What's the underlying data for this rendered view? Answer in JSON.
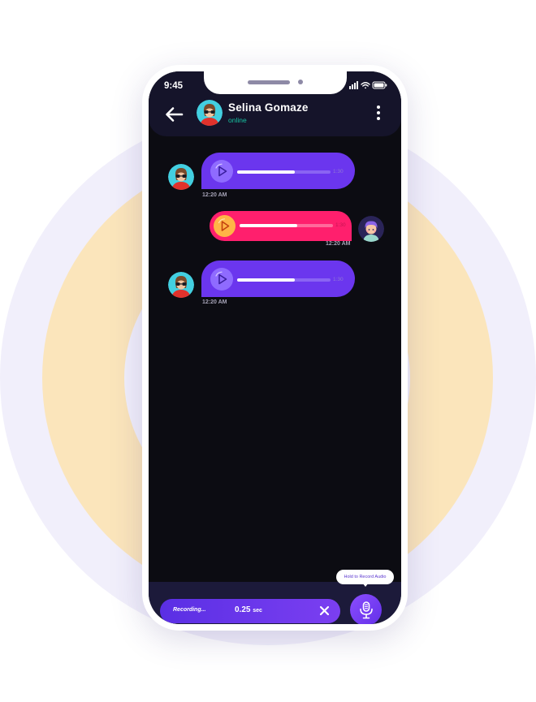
{
  "status_bar": {
    "time": "9:45"
  },
  "header": {
    "contact_name": "Selina Gomaze",
    "contact_status": "online",
    "icons": [
      "back-arrow-icon",
      "avatar",
      "more-vertical-icon"
    ]
  },
  "messages": [
    {
      "type": "voice",
      "direction": "received",
      "duration": "1:30",
      "time": "12:20 AM",
      "progress": 0.62,
      "color": "#6b36ee"
    },
    {
      "type": "voice",
      "direction": "sent",
      "duration": "1:30",
      "time": "12:20 AM",
      "progress": 0.62,
      "color": "#ff1f6d"
    },
    {
      "type": "voice",
      "direction": "received",
      "duration": "1:30",
      "time": "12:20 AM",
      "progress": 0.62,
      "color": "#6b36ee"
    }
  ],
  "recorder": {
    "status_label": "Recording...",
    "elapsed_value": "0.25",
    "elapsed_unit": "sec",
    "tooltip": "Hold to Record Audio",
    "icons": [
      "close-icon",
      "microphone-icon"
    ]
  },
  "colors": {
    "accent_purple": "#6b36ee",
    "accent_pink": "#ff1f6d",
    "online_green": "#17c2a1",
    "screen_bg": "#0c0c12"
  }
}
